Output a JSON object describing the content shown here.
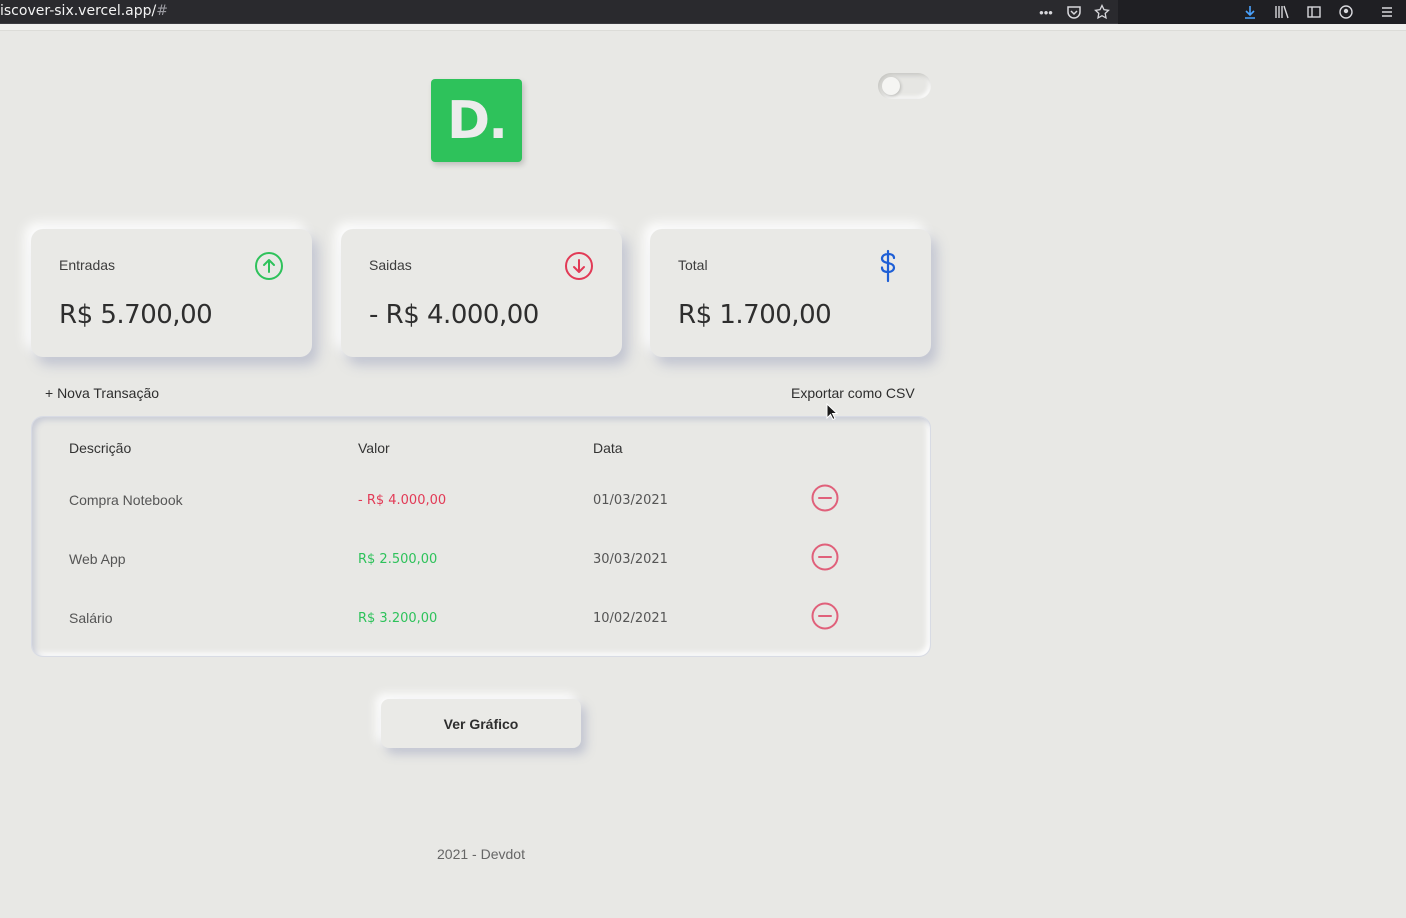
{
  "browser": {
    "url_main": "iscover-six.vercel.app/",
    "url_hash": "#"
  },
  "logo": {
    "text": "D."
  },
  "cards": [
    {
      "label": "Entradas",
      "value": "R$ 5.700,00",
      "icon": "arrow-up-circle-icon",
      "color": "#2ec25b"
    },
    {
      "label": "Saidas",
      "value": "- R$ 4.000,00",
      "icon": "arrow-down-circle-icon",
      "color": "#e23a56"
    },
    {
      "label": "Total",
      "value": "R$ 1.700,00",
      "icon": "dollar-sign-icon",
      "color": "#1e5fd6"
    }
  ],
  "actions": {
    "new_transaction": "+ Nova Transação",
    "export_csv": "Exportar como CSV"
  },
  "table": {
    "headers": [
      "Descrição",
      "Valor",
      "Data"
    ],
    "rows": [
      {
        "description": "Compra Notebook",
        "value": "- R$ 4.000,00",
        "type": "expense",
        "date": "01/03/2021"
      },
      {
        "description": "Web App",
        "value": "R$ 2.500,00",
        "type": "income",
        "date": "30/03/2021"
      },
      {
        "description": "Salário",
        "value": "R$ 3.200,00",
        "type": "income",
        "date": "10/02/2021"
      }
    ]
  },
  "chart_button": {
    "label": "Ver Gráfico"
  },
  "footer": {
    "text": "2021 - Devdot"
  },
  "colors": {
    "income": "#2ec25b",
    "expense": "#e23a56",
    "accent": "#1e5fd6",
    "background": "#e8e8e5"
  }
}
